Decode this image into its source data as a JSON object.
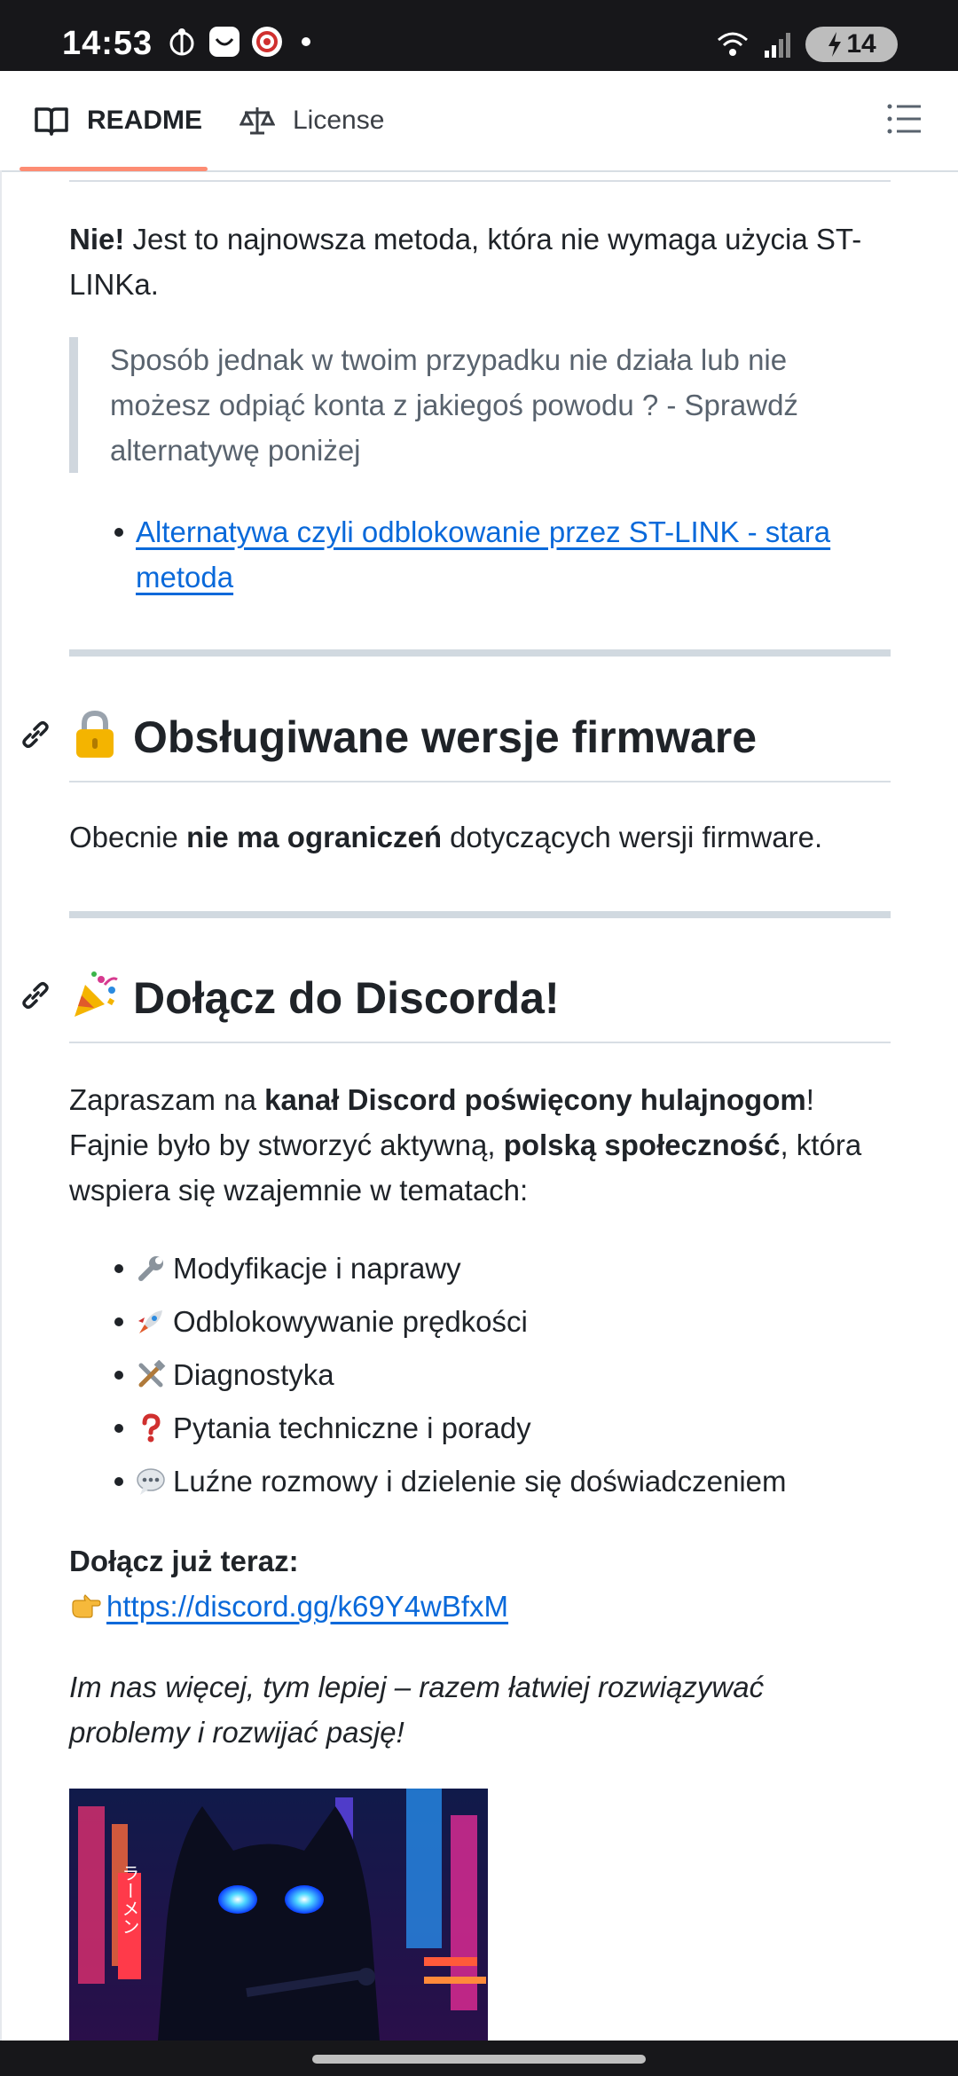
{
  "status_bar": {
    "time": "14:53",
    "battery": "14"
  },
  "tabs": {
    "readme": "README",
    "license": "License"
  },
  "intro": {
    "bold": "Nie!",
    "text": " Jest to najnowsza metoda, która nie wymaga użycia ST-LINKa."
  },
  "quote": "Sposób jednak w twoim przypadku nie działa lub nie możesz odpiąć konta z jakiegoś powodu ? - Sprawdź alternatywę poniżej",
  "alt_link": "Alternatywa czyli odblokowanie przez ST-LINK - stara metoda",
  "firmware": {
    "heading": "Obsługiwane wersje firmware",
    "pre": "Obecnie ",
    "bold": "nie ma ograniczeń",
    "post": " dotyczących wersji firmware."
  },
  "discord": {
    "heading": "Dołącz do Discorda!",
    "l1_pre": "Zapraszam na ",
    "l1_bold": "kanał Discord poświęcony hulajnogom",
    "l1_post": "!",
    "l2_pre": "Fajnie było by stworzyć aktywną, ",
    "l2_bold": "polską społeczność",
    "l2_post": ", która wspiera się wzajemnie w tematach:",
    "features": [
      {
        "icon": "wrench-icon",
        "text": "Modyfikacje i naprawy"
      },
      {
        "icon": "rocket-icon",
        "text": "Odblokowywanie prędkości"
      },
      {
        "icon": "tools-icon",
        "text": "Diagnostyka"
      },
      {
        "icon": "question-icon",
        "text": "Pytania techniczne i porady"
      },
      {
        "icon": "speech-bubble-icon",
        "text": "Luźne rozmowy i dzielenie się doświadczeniem"
      }
    ],
    "join_label": "Dołącz już teraz:",
    "join_link": "https://discord.gg/k69Y4wBfxM",
    "tagline": "Im nas więcej, tym lepiej – razem łatwiej rozwiązywać problemy i rozwijać pasję!"
  },
  "image": {
    "kanji": "ラーメン"
  }
}
